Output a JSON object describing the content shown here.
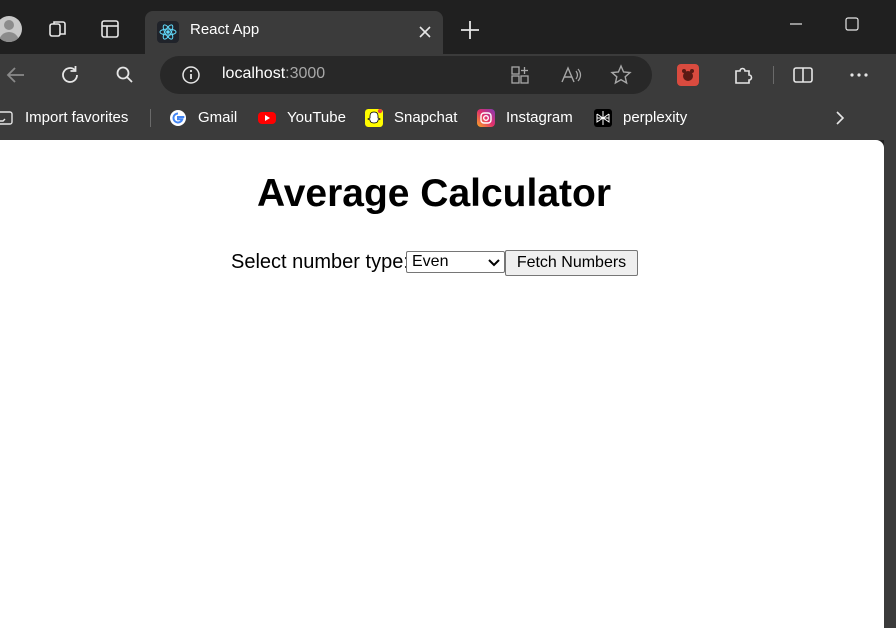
{
  "tab": {
    "title": "React App"
  },
  "address": {
    "host": "localhost",
    "port": ":3000"
  },
  "favorites": [
    {
      "label": "Import favorites"
    },
    {
      "label": "Gmail"
    },
    {
      "label": "YouTube"
    },
    {
      "label": "Snapchat"
    },
    {
      "label": "Instagram"
    },
    {
      "label": "perplexity"
    }
  ],
  "page": {
    "heading": "Average Calculator",
    "select_label": "Select number type:",
    "select_value": "Even",
    "button_label": "Fetch Numbers"
  }
}
